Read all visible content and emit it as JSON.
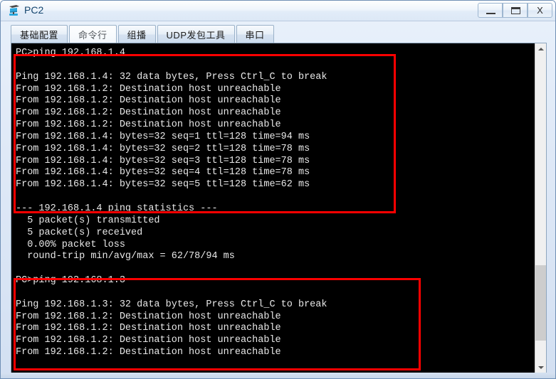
{
  "window": {
    "title": "PC2",
    "icon": "pc-device-icon",
    "controls": {
      "minimize_label": "—",
      "maximize_label": "□",
      "close_label": "X"
    }
  },
  "tabs": [
    {
      "label": "基础配置",
      "active": false
    },
    {
      "label": "命令行",
      "active": true
    },
    {
      "label": "组播",
      "active": false
    },
    {
      "label": "UDP发包工具",
      "active": false
    },
    {
      "label": "串口",
      "active": false
    }
  ],
  "console": {
    "background_color": "#000000",
    "text_color": "#e8e8e8",
    "lines": [
      "PC>ping 192.168.1.4",
      "",
      "Ping 192.168.1.4: 32 data bytes, Press Ctrl_C to break",
      "From 192.168.1.2: Destination host unreachable",
      "From 192.168.1.2: Destination host unreachable",
      "From 192.168.1.2: Destination host unreachable",
      "From 192.168.1.2: Destination host unreachable",
      "From 192.168.1.4: bytes=32 seq=1 ttl=128 time=94 ms",
      "From 192.168.1.4: bytes=32 seq=2 ttl=128 time=78 ms",
      "From 192.168.1.4: bytes=32 seq=3 ttl=128 time=78 ms",
      "From 192.168.1.4: bytes=32 seq=4 ttl=128 time=78 ms",
      "From 192.168.1.4: bytes=32 seq=5 ttl=128 time=62 ms",
      "",
      "--- 192.168.1.4 ping statistics ---",
      "  5 packet(s) transmitted",
      "  5 packet(s) received",
      "  0.00% packet loss",
      "  round-trip min/avg/max = 62/78/94 ms",
      "",
      "PC>ping 192.168.1.3",
      "",
      "Ping 192.168.1.3: 32 data bytes, Press Ctrl_C to break",
      "From 192.168.1.2: Destination host unreachable",
      "From 192.168.1.2: Destination host unreachable",
      "From 192.168.1.2: Destination host unreachable",
      "From 192.168.1.2: Destination host unreachable"
    ]
  },
  "annotations": {
    "color": "#ff0000",
    "boxes": [
      {
        "name": "ping-192.168.1.4-highlight"
      },
      {
        "name": "ping-192.168.1.3-highlight"
      }
    ]
  },
  "scrollbar": {
    "up_arrow": "▲",
    "down_arrow": "▼",
    "orientation": "vertical"
  }
}
